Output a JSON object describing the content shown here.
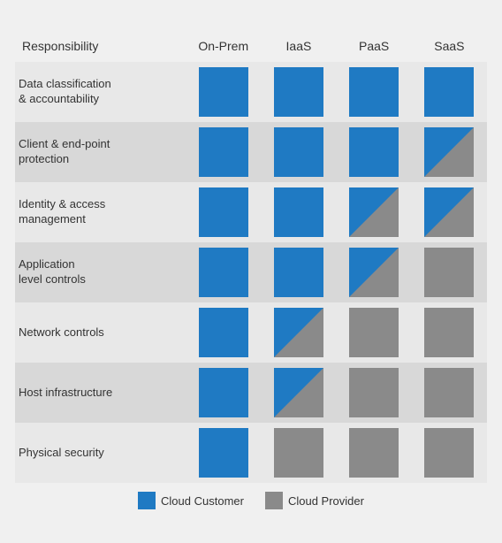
{
  "header": {
    "col0": "Responsibility",
    "col1": "On-Prem",
    "col2": "IaaS",
    "col3": "PaaS",
    "col4": "SaaS"
  },
  "rows": [
    {
      "label": "Data classification\n& accountability",
      "onprem": "full-blue",
      "iaas": "full-blue",
      "paas": "full-blue",
      "saas": "full-blue"
    },
    {
      "label": "Client & end-point\nprotection",
      "onprem": "full-blue",
      "iaas": "full-blue",
      "paas": "full-blue",
      "saas": "split-gray-topleft"
    },
    {
      "label": "Identity & access\nmanagement",
      "onprem": "full-blue",
      "iaas": "full-blue",
      "paas": "split-gray-topleft",
      "saas": "split-gray-topleft"
    },
    {
      "label": "Application\nlevel controls",
      "onprem": "full-blue",
      "iaas": "full-blue",
      "paas": "split-blue-topleft",
      "saas": "full-gray"
    },
    {
      "label": "Network controls",
      "onprem": "full-blue",
      "iaas": "split-gray-topleft",
      "paas": "full-gray",
      "saas": "full-gray"
    },
    {
      "label": "Host infrastructure",
      "onprem": "full-blue",
      "iaas": "split-blue-topleft",
      "paas": "full-gray",
      "saas": "full-gray"
    },
    {
      "label": "Physical security",
      "onprem": "full-blue",
      "iaas": "full-gray",
      "paas": "full-gray",
      "saas": "full-gray"
    }
  ],
  "legend": {
    "customer_label": "Cloud Customer",
    "provider_label": "Cloud Provider"
  }
}
